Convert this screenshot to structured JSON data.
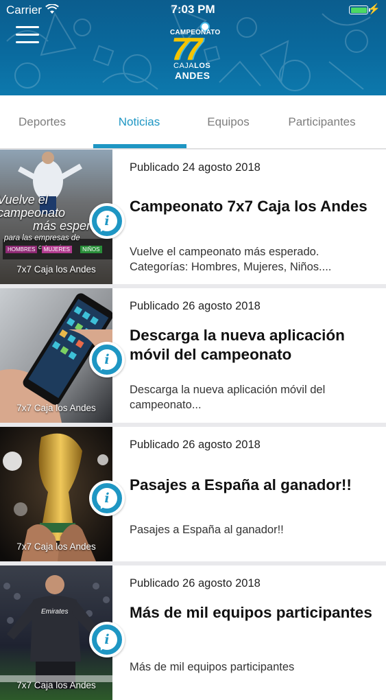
{
  "status_bar": {
    "carrier": "Carrier",
    "time": "7:03 PM"
  },
  "header": {
    "logo": {
      "top": "CAMPEONATO",
      "number": "77",
      "caja": "CAJA",
      "los": "LOS",
      "andes": "ANDES"
    }
  },
  "tabs": [
    {
      "label": "Deportes",
      "active": false
    },
    {
      "label": "Noticias",
      "active": true
    },
    {
      "label": "Equipos",
      "active": false
    },
    {
      "label": "Participantes",
      "active": false
    }
  ],
  "news": [
    {
      "date": "Publicado 24 agosto 2018",
      "title": "Campeonato 7x7 Caja los Andes",
      "summary": "Vuelve el campeonato más esperado. Categorías: Hombres, Mujeres, Niños....",
      "caption": "7x7 Caja los Andes",
      "thumb_text": {
        "line1": "Vuelve el campeonato",
        "line2": "más esperado",
        "line3": "para las empresas de",
        "line4": "categorías",
        "cat1": "HOMBRES",
        "cat2": "MUJERES",
        "cat3": "NIÑOS"
      }
    },
    {
      "date": "Publicado 26 agosto 2018",
      "title": "Descarga la nueva aplicación móvil del campeonato",
      "summary": "Descarga la nueva aplicación móvil del campeonato...",
      "caption": "7x7 Caja los Andes"
    },
    {
      "date": "Publicado 26 agosto 2018",
      "title": "Pasajes a España al ganador!!",
      "summary": "Pasajes a España al ganador!!",
      "caption": "7x7 Caja los Andes"
    },
    {
      "date": "Publicado 26 agosto 2018",
      "title": "Más de mil equipos participantes",
      "summary": "Más de mil equipos participantes",
      "caption": "7x7 Caja los Andes",
      "thumb_text": {
        "shirt": "Emirates"
      }
    }
  ]
}
